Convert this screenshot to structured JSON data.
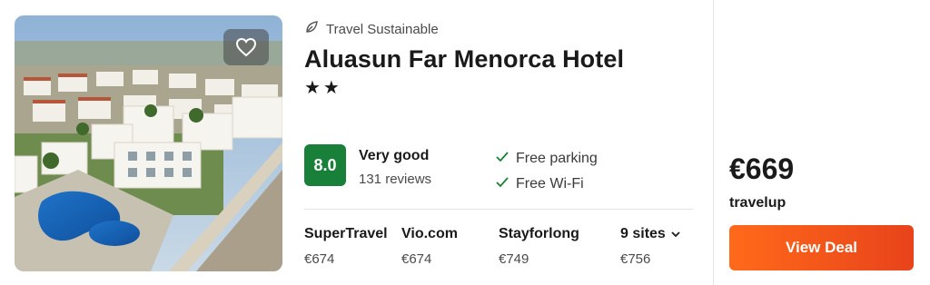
{
  "hotel": {
    "badge_label": "Travel Sustainable",
    "name": "Aluasun Far Menorca Hotel",
    "stars": "★★",
    "score": "8.0",
    "rating_label": "Very good",
    "reviews": "131 reviews",
    "amenities": [
      "Free parking",
      "Free Wi-Fi"
    ]
  },
  "sites": [
    {
      "name": "SuperTravel",
      "price": "€674"
    },
    {
      "name": "Vio.com",
      "price": "€674"
    },
    {
      "name": "Stayforlong",
      "price": "€749"
    }
  ],
  "more_sites": {
    "label": "9 sites",
    "price": "€756"
  },
  "deal": {
    "price": "€669",
    "provider": "travelup",
    "button_label": "View Deal"
  },
  "colors": {
    "score_green": "#188038",
    "deal_orange": "#ff5b1a",
    "check_green": "#1a7f37"
  },
  "icons": {
    "favorite": "heart-icon",
    "sustainable": "leaf-icon",
    "amenity": "checkmark-icon",
    "expand": "chevron-down-icon"
  }
}
